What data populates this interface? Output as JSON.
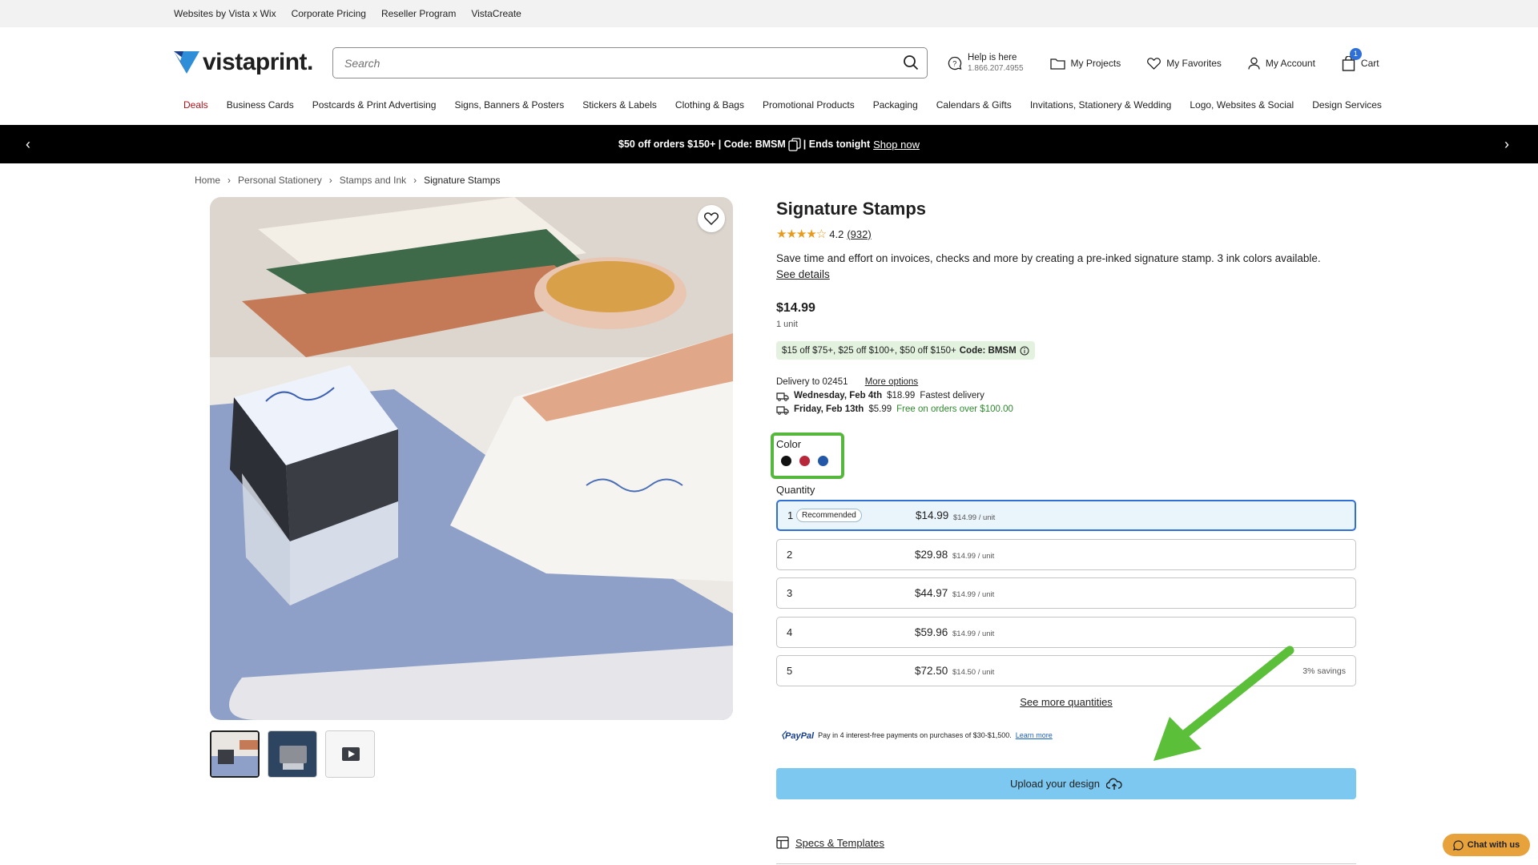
{
  "util_links": [
    "Websites by Vista x Wix",
    "Corporate Pricing",
    "Reseller Program",
    "VistaCreate"
  ],
  "header": {
    "logo_text": "vistaprint.",
    "search_placeholder": "Search",
    "help_label": "Help is here",
    "help_phone": "1.866.207.4955",
    "projects": "My Projects",
    "favorites": "My Favorites",
    "account": "My Account",
    "cart": "Cart",
    "cart_count": "1"
  },
  "nav": [
    "Deals",
    "Business Cards",
    "Postcards & Print Advertising",
    "Signs, Banners & Posters",
    "Stickers & Labels",
    "Clothing & Bags",
    "Promotional Products",
    "Packaging",
    "Calendars & Gifts",
    "Invitations, Stationery & Wedding",
    "Logo, Websites & Social",
    "Design Services"
  ],
  "promo": {
    "text_a": "$50 off orders $150+ | Code: BMSM",
    "text_b": "| Ends tonight",
    "shop": "Shop now"
  },
  "breadcrumb": [
    "Home",
    "Personal Stationery",
    "Stamps and Ink",
    "Signature Stamps"
  ],
  "product": {
    "title": "Signature Stamps",
    "rating": "4.2",
    "reviews": "(932)",
    "rating_value": 4.2,
    "description": "Save time and effort on invoices, checks and more by creating a pre-inked signature stamp. 3 ink colors available.",
    "see_details": "See details",
    "price": "$14.99",
    "unit": "1 unit",
    "promo_tag": "$15 off $75+, $25 off $100+, $50 off $150+",
    "promo_code": "Code: BMSM",
    "delivery_to": "Delivery to 02451",
    "more_options": "More options",
    "delivery": [
      {
        "date": "Wednesday, Feb 4th",
        "price": "$18.99",
        "note": "Fastest delivery"
      },
      {
        "date": "Friday, Feb 13th",
        "price": "$5.99",
        "note": "Free on orders over $100.00"
      }
    ],
    "color_label": "Color",
    "colors": [
      "#111111",
      "#b8283a",
      "#2358a8"
    ],
    "quantity_label": "Quantity",
    "quantities": [
      {
        "n": "1",
        "badge": "Recommended",
        "total": "$14.99",
        "per": "$14.99 / unit",
        "savings": ""
      },
      {
        "n": "2",
        "badge": "",
        "total": "$29.98",
        "per": "$14.99 / unit",
        "savings": ""
      },
      {
        "n": "3",
        "badge": "",
        "total": "$44.97",
        "per": "$14.99 / unit",
        "savings": ""
      },
      {
        "n": "4",
        "badge": "",
        "total": "$59.96",
        "per": "$14.99 / unit",
        "savings": ""
      },
      {
        "n": "5",
        "badge": "",
        "total": "$72.50",
        "per": "$14.50 / unit",
        "savings": "3% savings"
      }
    ],
    "see_more_quantities": "See more quantities",
    "paypal_brand": "PayPal",
    "paypal_text": "Pay in 4 interest-free payments on purchases of $30-$1,500.",
    "paypal_learn": "Learn more",
    "upload_label": "Upload your design",
    "specs_label": "Specs & Templates"
  },
  "chat_label": "Chat with us"
}
